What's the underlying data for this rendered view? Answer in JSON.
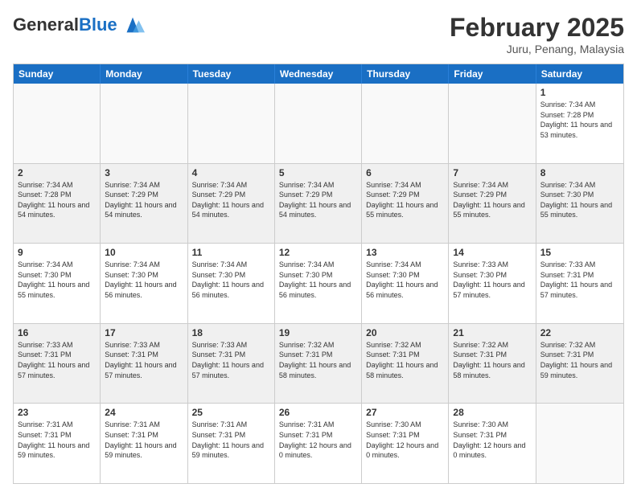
{
  "logo": {
    "line1": "General",
    "line2": "Blue"
  },
  "title": "February 2025",
  "subtitle": "Juru, Penang, Malaysia",
  "days_of_week": [
    "Sunday",
    "Monday",
    "Tuesday",
    "Wednesday",
    "Thursday",
    "Friday",
    "Saturday"
  ],
  "weeks": [
    {
      "shaded": false,
      "cells": [
        {
          "day": "",
          "info": ""
        },
        {
          "day": "",
          "info": ""
        },
        {
          "day": "",
          "info": ""
        },
        {
          "day": "",
          "info": ""
        },
        {
          "day": "",
          "info": ""
        },
        {
          "day": "",
          "info": ""
        },
        {
          "day": "1",
          "info": "Sunrise: 7:34 AM\nSunset: 7:28 PM\nDaylight: 11 hours\nand 53 minutes."
        }
      ]
    },
    {
      "shaded": true,
      "cells": [
        {
          "day": "2",
          "info": "Sunrise: 7:34 AM\nSunset: 7:28 PM\nDaylight: 11 hours\nand 54 minutes."
        },
        {
          "day": "3",
          "info": "Sunrise: 7:34 AM\nSunset: 7:29 PM\nDaylight: 11 hours\nand 54 minutes."
        },
        {
          "day": "4",
          "info": "Sunrise: 7:34 AM\nSunset: 7:29 PM\nDaylight: 11 hours\nand 54 minutes."
        },
        {
          "day": "5",
          "info": "Sunrise: 7:34 AM\nSunset: 7:29 PM\nDaylight: 11 hours\nand 54 minutes."
        },
        {
          "day": "6",
          "info": "Sunrise: 7:34 AM\nSunset: 7:29 PM\nDaylight: 11 hours\nand 55 minutes."
        },
        {
          "day": "7",
          "info": "Sunrise: 7:34 AM\nSunset: 7:29 PM\nDaylight: 11 hours\nand 55 minutes."
        },
        {
          "day": "8",
          "info": "Sunrise: 7:34 AM\nSunset: 7:30 PM\nDaylight: 11 hours\nand 55 minutes."
        }
      ]
    },
    {
      "shaded": false,
      "cells": [
        {
          "day": "9",
          "info": "Sunrise: 7:34 AM\nSunset: 7:30 PM\nDaylight: 11 hours\nand 55 minutes."
        },
        {
          "day": "10",
          "info": "Sunrise: 7:34 AM\nSunset: 7:30 PM\nDaylight: 11 hours\nand 56 minutes."
        },
        {
          "day": "11",
          "info": "Sunrise: 7:34 AM\nSunset: 7:30 PM\nDaylight: 11 hours\nand 56 minutes."
        },
        {
          "day": "12",
          "info": "Sunrise: 7:34 AM\nSunset: 7:30 PM\nDaylight: 11 hours\nand 56 minutes."
        },
        {
          "day": "13",
          "info": "Sunrise: 7:34 AM\nSunset: 7:30 PM\nDaylight: 11 hours\nand 56 minutes."
        },
        {
          "day": "14",
          "info": "Sunrise: 7:33 AM\nSunset: 7:30 PM\nDaylight: 11 hours\nand 57 minutes."
        },
        {
          "day": "15",
          "info": "Sunrise: 7:33 AM\nSunset: 7:31 PM\nDaylight: 11 hours\nand 57 minutes."
        }
      ]
    },
    {
      "shaded": true,
      "cells": [
        {
          "day": "16",
          "info": "Sunrise: 7:33 AM\nSunset: 7:31 PM\nDaylight: 11 hours\nand 57 minutes."
        },
        {
          "day": "17",
          "info": "Sunrise: 7:33 AM\nSunset: 7:31 PM\nDaylight: 11 hours\nand 57 minutes."
        },
        {
          "day": "18",
          "info": "Sunrise: 7:33 AM\nSunset: 7:31 PM\nDaylight: 11 hours\nand 57 minutes."
        },
        {
          "day": "19",
          "info": "Sunrise: 7:32 AM\nSunset: 7:31 PM\nDaylight: 11 hours\nand 58 minutes."
        },
        {
          "day": "20",
          "info": "Sunrise: 7:32 AM\nSunset: 7:31 PM\nDaylight: 11 hours\nand 58 minutes."
        },
        {
          "day": "21",
          "info": "Sunrise: 7:32 AM\nSunset: 7:31 PM\nDaylight: 11 hours\nand 58 minutes."
        },
        {
          "day": "22",
          "info": "Sunrise: 7:32 AM\nSunset: 7:31 PM\nDaylight: 11 hours\nand 59 minutes."
        }
      ]
    },
    {
      "shaded": false,
      "cells": [
        {
          "day": "23",
          "info": "Sunrise: 7:31 AM\nSunset: 7:31 PM\nDaylight: 11 hours\nand 59 minutes."
        },
        {
          "day": "24",
          "info": "Sunrise: 7:31 AM\nSunset: 7:31 PM\nDaylight: 11 hours\nand 59 minutes."
        },
        {
          "day": "25",
          "info": "Sunrise: 7:31 AM\nSunset: 7:31 PM\nDaylight: 11 hours\nand 59 minutes."
        },
        {
          "day": "26",
          "info": "Sunrise: 7:31 AM\nSunset: 7:31 PM\nDaylight: 12 hours\nand 0 minutes."
        },
        {
          "day": "27",
          "info": "Sunrise: 7:30 AM\nSunset: 7:31 PM\nDaylight: 12 hours\nand 0 minutes."
        },
        {
          "day": "28",
          "info": "Sunrise: 7:30 AM\nSunset: 7:31 PM\nDaylight: 12 hours\nand 0 minutes."
        },
        {
          "day": "",
          "info": ""
        }
      ]
    }
  ]
}
